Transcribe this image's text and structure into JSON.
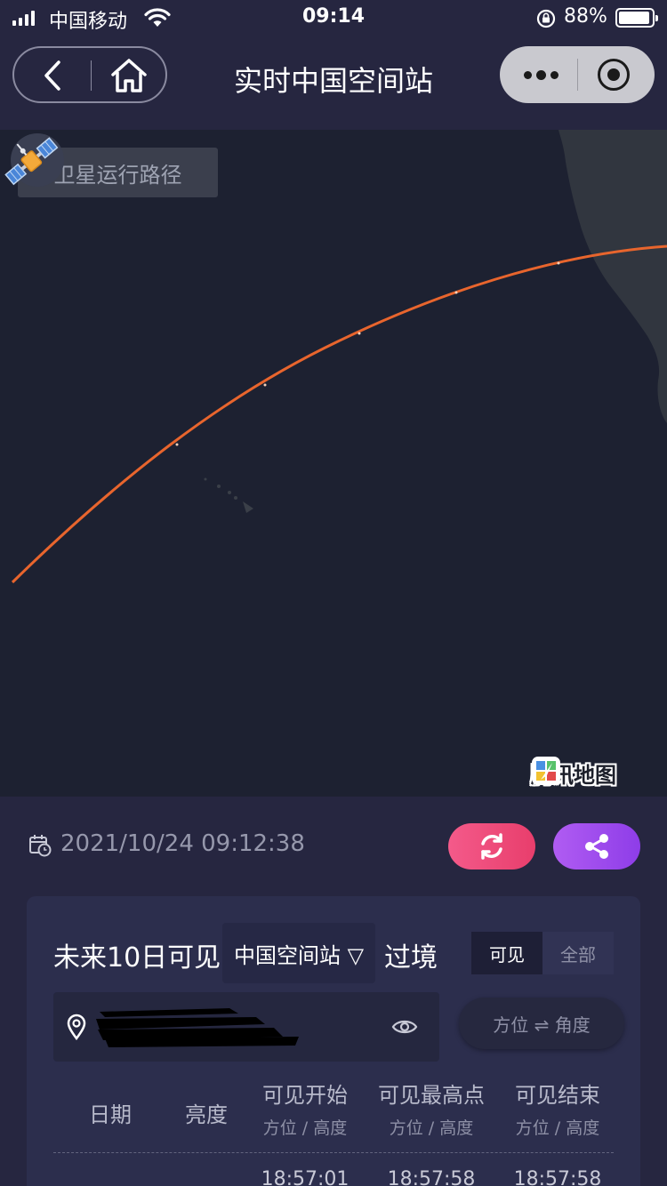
{
  "status_bar": {
    "carrier": "中国移动",
    "time": "09:14",
    "battery": "88%",
    "battery_level": 0.88
  },
  "nav": {
    "title": "实时中国空间站",
    "back_icon": "chevron-left-icon",
    "home_icon": "home-icon",
    "more_icon": "more-dots-icon",
    "close_icon": "target-circle-icon"
  },
  "map": {
    "route_button": "卫星运行路径",
    "provider": "腾讯地图",
    "route_color": "#e8652d",
    "satellite_icon": "satellite-icon"
  },
  "info": {
    "datetime": "2021/10/24 09:12:38",
    "refresh_icon": "refresh-icon",
    "share_icon": "share-icon",
    "refresh_color": "#f45a8a",
    "share_color": "#a04ced"
  },
  "passes": {
    "prefix": "未来10日可见",
    "station": "中国空间站 ▽",
    "suffix": "过境",
    "toggle": {
      "active": "可见",
      "inactive": "全部"
    },
    "orientation_toggle": "方位 ⇌ 角度",
    "columns": [
      {
        "title": "日期",
        "sub": ""
      },
      {
        "title": "亮度",
        "sub": ""
      },
      {
        "title": "可见开始",
        "sub": "方位 / 高度"
      },
      {
        "title": "可见最高点",
        "sub": "方位 / 高度"
      },
      {
        "title": "可见结束",
        "sub": "方位 / 高度"
      }
    ],
    "rows": [
      {
        "date": "",
        "brightness": "",
        "start": "18:57:01",
        "peak": "18:57:58",
        "end": "18:57:58"
      }
    ]
  }
}
